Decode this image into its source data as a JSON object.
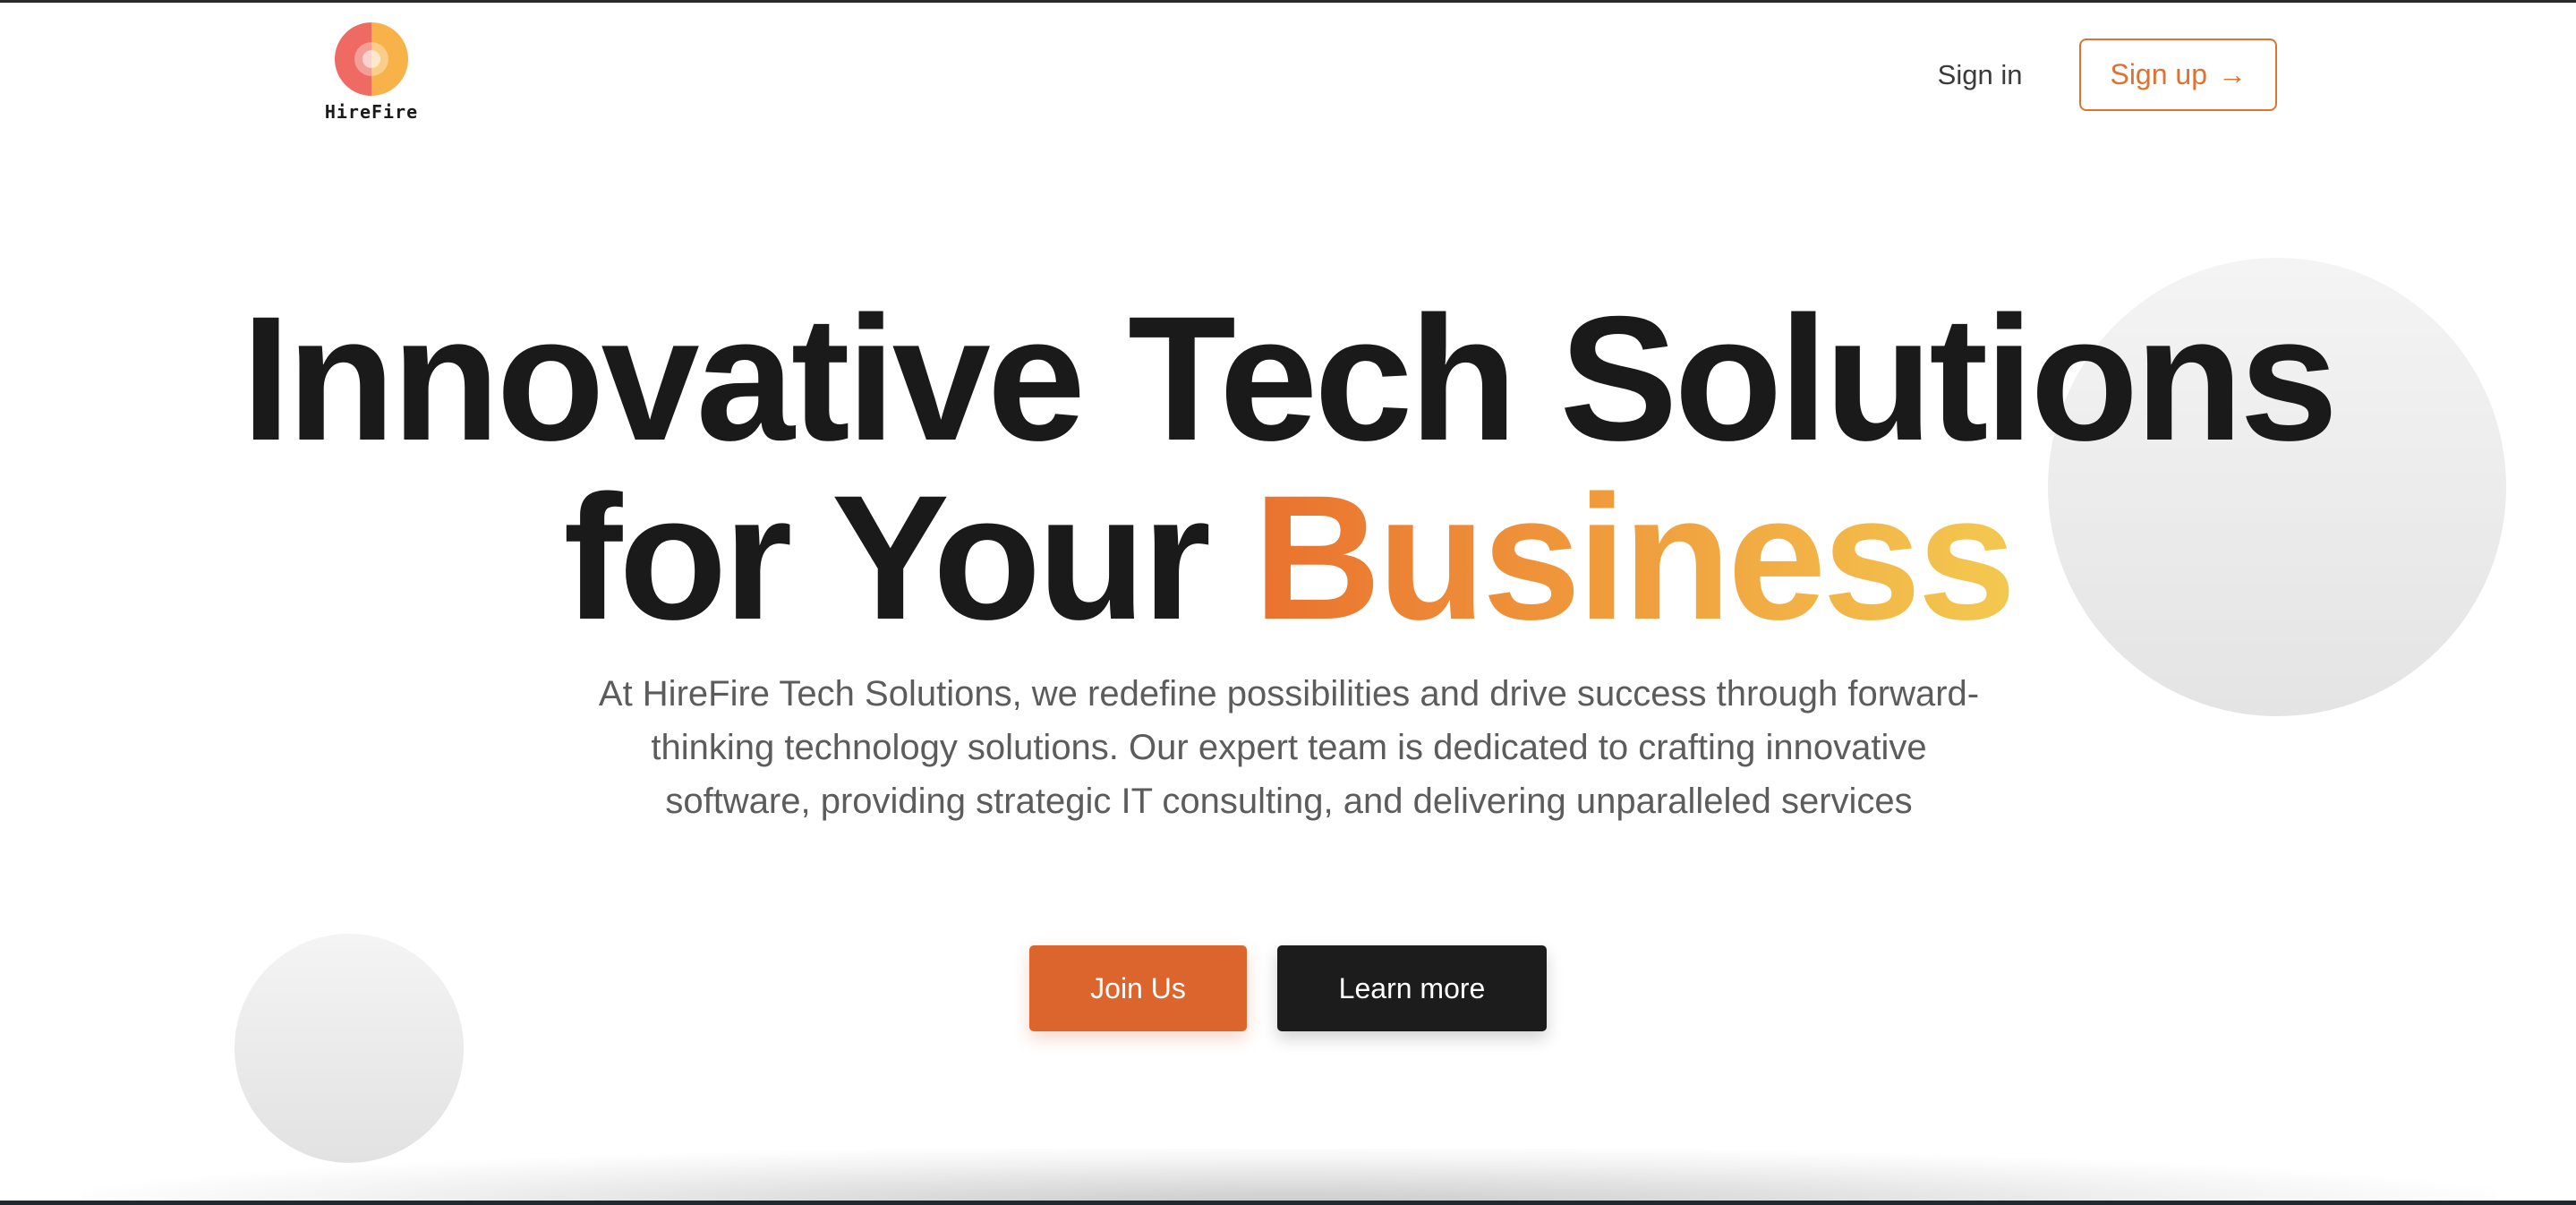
{
  "brand": {
    "name": "HireFire",
    "colors": {
      "red": "#ee6a62",
      "orange": "#f7b24a",
      "accent": "#e07130"
    }
  },
  "nav": {
    "signin_label": "Sign in",
    "signup_label": "Sign up",
    "signup_icon": "arrow-right-icon"
  },
  "hero": {
    "title_line1": "Innovative Tech Solutions",
    "title_line2_prefix": "for Your ",
    "title_line2_accent": "Business",
    "subtitle": "At HireFire Tech Solutions, we redefine possibilities and drive success through forward-thinking technology solutions. Our expert team is dedicated to crafting innovative software, providing strategic IT consulting, and delivering unparalleled services",
    "accent_gradient": [
      "#e9712f",
      "#f3c950"
    ]
  },
  "cta": {
    "join_label": "Join Us",
    "learn_label": "Learn more",
    "join_color": "#dc652d",
    "learn_color": "#1c1c1c"
  }
}
